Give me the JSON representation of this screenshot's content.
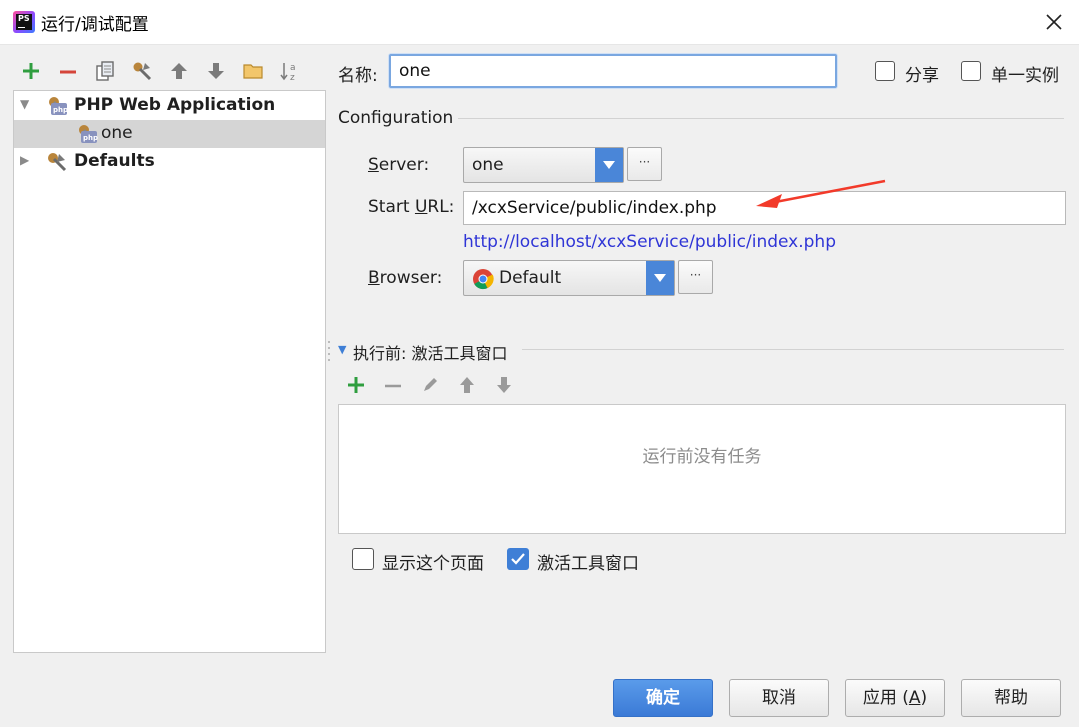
{
  "window": {
    "title": "运行/调试配置",
    "close_icon": "close-icon"
  },
  "left_toolbar": [
    "add-icon",
    "remove-icon",
    "copy-icon",
    "edit-defaults-icon",
    "move-up-icon",
    "move-down-icon",
    "folder-icon",
    "sort-icon"
  ],
  "tree": {
    "items": [
      {
        "label": "PHP Web Application",
        "expanded": true,
        "bold": true
      },
      {
        "label": "one",
        "selected": true
      },
      {
        "label": "Defaults",
        "expanded": false,
        "bold": true
      }
    ]
  },
  "form": {
    "name_label": "名称:",
    "name_value": "one",
    "share_label": "分享",
    "share_checked": false,
    "single_instance_label": "单一实例",
    "single_instance_checked": false,
    "configuration_title": "Configuration",
    "server_label_pre": "",
    "server_label_mnemonic": "S",
    "server_label_post": "erver:",
    "server_value": "one",
    "start_url_label_pre": "Start ",
    "start_url_label_mnemonic": "U",
    "start_url_label_post": "RL:",
    "start_url_value": "/xcxService/public/index.php",
    "resolved_url": "http://localhost/xcxService/public/index.php",
    "browser_label_pre": "",
    "browser_label_mnemonic": "B",
    "browser_label_post": "rowser:",
    "browser_value": "Default",
    "more_button": "···"
  },
  "before_launch": {
    "title": "执行前: 激活工具窗口",
    "icons": [
      "add-icon",
      "remove-icon",
      "edit-icon",
      "move-up-icon",
      "move-down-icon"
    ],
    "empty_text": "运行前没有任务",
    "show_page_label": "显示这个页面",
    "show_page_checked": false,
    "activate_window_label": "激活工具窗口",
    "activate_window_checked": true
  },
  "buttons": {
    "ok": "确定",
    "cancel": "取消",
    "apply_pre": "应用 (",
    "apply_mnemonic": "A",
    "apply_post": ")",
    "help": "帮助"
  },
  "colors": {
    "accent": "#3b7ad6",
    "link": "#2f35d6",
    "annotation_arrow": "#f23a2a"
  }
}
